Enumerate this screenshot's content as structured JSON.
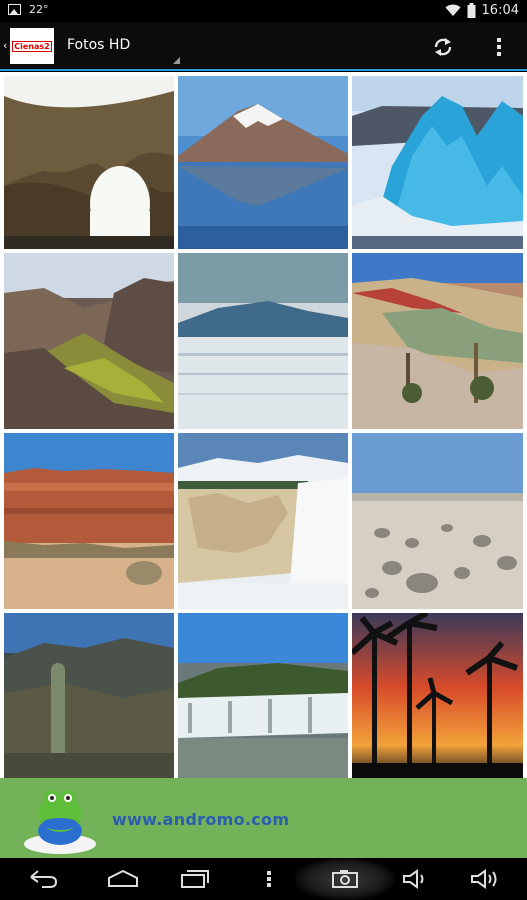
{
  "status_bar": {
    "temperature": "22°",
    "time": "16:04",
    "icons": [
      "image-notification-icon",
      "wifi-icon",
      "battery-icon"
    ]
  },
  "action_bar": {
    "app_icon_label": "Cienas2",
    "title": "Fotos HD",
    "actions": [
      "refresh-icon",
      "overflow-menu-icon"
    ]
  },
  "gallery": {
    "columns": 3,
    "rows": 4,
    "photos": [
      {
        "subject": "sea cave arch"
      },
      {
        "subject": "snowy volcano over lake"
      },
      {
        "subject": "glacier ice"
      },
      {
        "subject": "rocky canyon"
      },
      {
        "subject": "misty lake with mountain"
      },
      {
        "subject": "colored hills"
      },
      {
        "subject": "red cliffs"
      },
      {
        "subject": "waterfall cascade"
      },
      {
        "subject": "stone field"
      },
      {
        "subject": "mountain with cactus"
      },
      {
        "subject": "waterfalls"
      },
      {
        "subject": "palm tree sunset"
      }
    ]
  },
  "ad_banner": {
    "text": "www.andromo.com",
    "icon": "andromo-mascot-icon"
  },
  "nav_bar": {
    "buttons": [
      "back-icon",
      "home-icon",
      "recent-apps-icon",
      "menu-dots-icon",
      "screenshot-icon",
      "volume-down-icon",
      "volume-up-icon"
    ]
  },
  "colors": {
    "accent": "#2a9bd6",
    "ad_background": "#74b259",
    "ad_text": "#2a5db0"
  }
}
